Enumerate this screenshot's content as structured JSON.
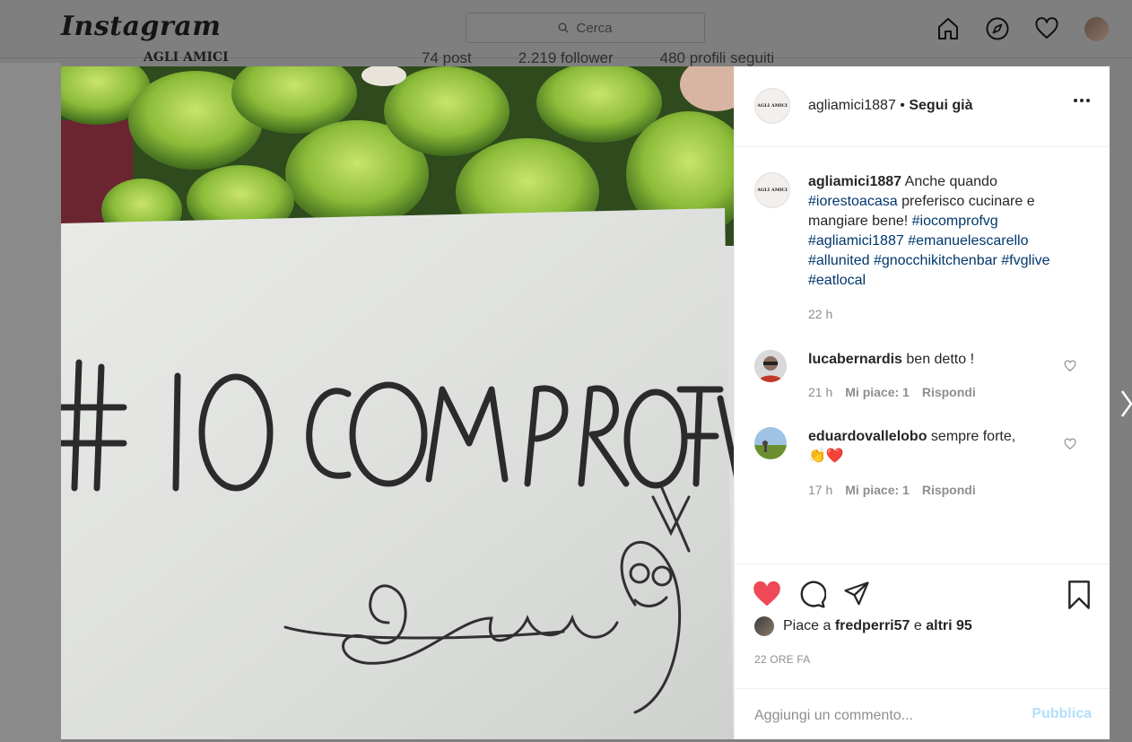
{
  "nav": {
    "logo": "Instagram",
    "search_placeholder": "Cerca",
    "icons": [
      "home-icon",
      "explore-icon",
      "activity-heart-icon",
      "profile-avatar"
    ]
  },
  "background": {
    "profile_logo": "AGLI AMICI",
    "stats": [
      "74 post",
      "2.219 follower",
      "480 profili seguiti"
    ]
  },
  "photo": {
    "handwritten_text": "#IOCOMPROFVG",
    "signature": "Emanuele"
  },
  "post": {
    "header": {
      "username": "agliamici1887",
      "separator": " • ",
      "follow_status": "Segui già"
    },
    "caption": {
      "username": "agliamici1887",
      "text_1": "Anche quando",
      "tag_1": "#iorestoacasa",
      "text_2": "preferisco cucinare e mangiare bene!",
      "tag_2": "#iocomprofvg",
      "tag_3": "#agliamici1887",
      "tag_4": "#emanuelescarello",
      "tag_5": "#allunited",
      "tag_6": "#gnocchikitchenbar",
      "tag_7": "#fvglive",
      "tag_8": "#eatlocal",
      "time": "22 h"
    },
    "comments": [
      {
        "username": "lucabernardis",
        "text": "ben detto !",
        "time": "21 h",
        "likes": "Mi piace: 1",
        "reply": "Rispondi"
      },
      {
        "username": "eduardovallelobo",
        "text": "sempre forte,",
        "emoji": "👏❤️",
        "time": "17 h",
        "likes": "Mi piace: 1",
        "reply": "Rispondi"
      }
    ],
    "likes": {
      "prefix": "Piace a",
      "user": "fredperri57",
      "conj": "e",
      "others": "altri 95"
    },
    "timestamp": "22 ORE FA",
    "add_comment_placeholder": "Aggiungi un commento...",
    "publish_label": "Pubblica",
    "colors": {
      "like_red": "#ed4956",
      "hashtag": "#00376b",
      "publish_disabled": "#b2dffc"
    }
  }
}
